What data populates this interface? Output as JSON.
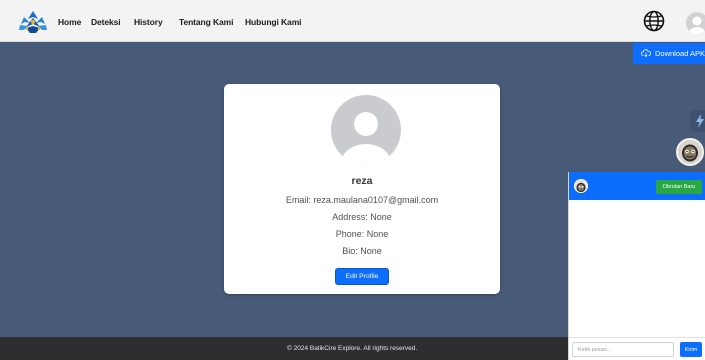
{
  "navbar": {
    "links": [
      "Home",
      "Deteksi",
      "History",
      "Tentang Kami",
      "Hubungi Kami"
    ],
    "icons": {
      "logo": "batik-logo-icon",
      "language": "globe-icon",
      "user": "user-avatar-icon"
    }
  },
  "download": {
    "label": "Download APK",
    "icon": "cloud-download-icon"
  },
  "floating": {
    "bolt_icon": "bolt-icon",
    "bot_icon": "mask-bot-icon"
  },
  "profile": {
    "username": "reza",
    "email": "Email: reza.maulana0107@gmail.com",
    "address": "Address: None",
    "phone": "Phone: None",
    "bio": "Bio: None",
    "edit_label": "Edit Profile"
  },
  "footer": {
    "text": "© 2024 BatikCire Explore. All rights reserved."
  },
  "chat": {
    "new_chat_label": "Obrolan Baru",
    "input_placeholder": "Ketik pesan...",
    "send_label": "Kirim"
  },
  "colors": {
    "page_bg": "#475a78",
    "primary": "#0d6efd",
    "success": "#28a745",
    "footer": "#2e2e2e",
    "navbar": "#f3f3f3"
  }
}
